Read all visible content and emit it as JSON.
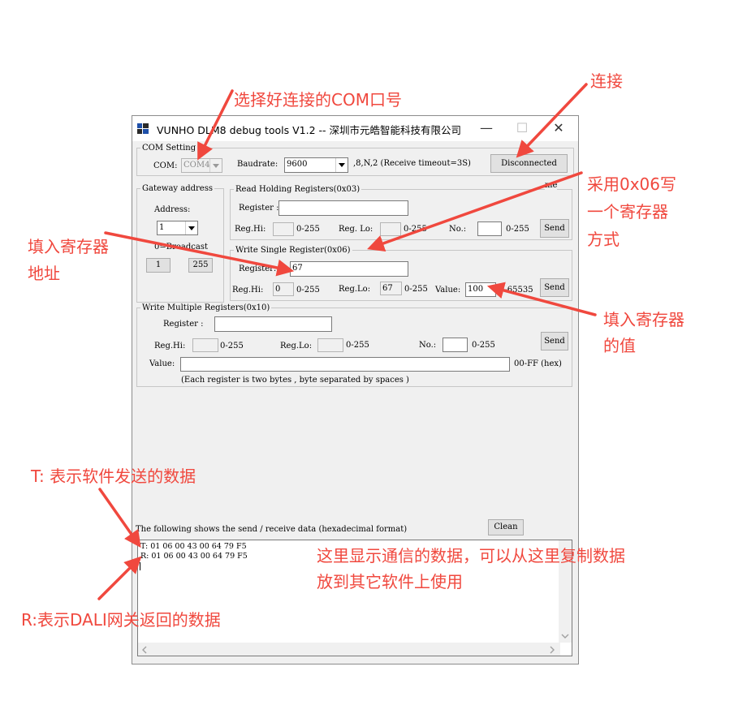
{
  "window": {
    "title": "VUNHO DLM8 debug tools V1.2  -- 深圳市元皓智能科技有限公司",
    "minimize": "—",
    "maximize": "☐",
    "close": "✕"
  },
  "com_setting": {
    "legend": "COM Setting",
    "com_label": "COM:",
    "com_value": "COM4",
    "baud_label": "Baudrate:",
    "baud_value": "9600",
    "params": ",8,N,2  (Receive timeout=3S)",
    "connect_button": "Disconnected"
  },
  "gateway": {
    "legend": "Gateway address",
    "address_label": "Address:",
    "address_value": "1",
    "broadcast_label": "0=Broadcast",
    "btn_1": "1",
    "btn_255": "255"
  },
  "read_holding": {
    "legend": "Read Holding Registers(0x03)",
    "register_label": "Register :",
    "register_value": "",
    "reghi_label": "Reg.Hi:",
    "reghi_range": "0-255",
    "reglo_label": "Reg. Lo:",
    "reglo_range": "0-255",
    "no_label": "No.:",
    "no_range": "0-255",
    "send": "Send",
    "me_label": "me"
  },
  "write_single": {
    "legend": "Write Single Register(0x06)",
    "register_label": "Register:",
    "register_value": "67",
    "reghi_label": "Reg.Hi:",
    "reghi_value": "0",
    "reghi_range": "0-255",
    "reglo_label": "Reg.Lo:",
    "reglo_value": "67",
    "reglo_range": "0-255",
    "value_label": "Value:",
    "value_value": "100",
    "value_range": "0-65535",
    "send": "Send"
  },
  "write_multiple": {
    "legend": "Write Multiple Registers(0x10)",
    "register_label": "Register :",
    "reghi_label": "Reg.Hi:",
    "reghi_range": "0-255",
    "reglo_label": "Reg.Lo:",
    "reglo_range": "0-255",
    "no_label": "No.:",
    "no_range": "0-255",
    "send": "Send",
    "value_label": "Value:",
    "value_range": "00-FF (hex)",
    "note": "(Each register is two bytes , byte separated by spaces )"
  },
  "log": {
    "header": "The following shows the send / receive data (hexadecimal format)",
    "clean_button": "Clean",
    "lines": [
      "T: 01 06 00 43 00 64 79 F5",
      "R: 01 06 00 43 00 64 79 F5"
    ]
  },
  "annotations": {
    "select_com": "选择好连接的COM口号",
    "connect": "连接",
    "use_0x06_1": "采用0x06写",
    "use_0x06_2": "一个寄存器",
    "use_0x06_3": "方式",
    "fill_addr_1": "填入寄存器",
    "fill_addr_2": "地址",
    "fill_value_1": "填入寄存器",
    "fill_value_2": "的值",
    "t_desc": "T:  表示软件发送的数据",
    "data_desc_1": "这里显示通信的数据，可以从这里复制数据",
    "data_desc_2": "放到其它软件上使用",
    "r_desc": "R:表示DALI网关返回的数据",
    "color": "#f0483e"
  }
}
